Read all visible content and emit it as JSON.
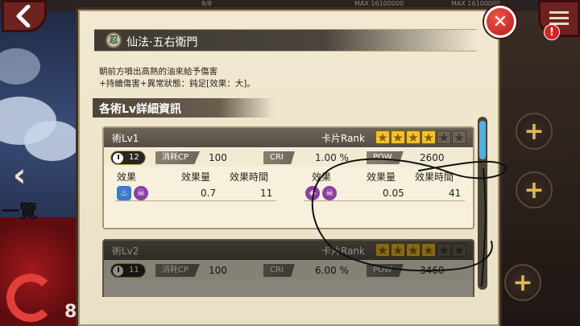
{
  "top_bar": {
    "item1": "8/8",
    "item2": "MAX 16100000",
    "item3": "MAX 16100000"
  },
  "dialog": {
    "title": "仙法·五右衛門",
    "title_badge": "忍",
    "description_line1": "朝前方噴出高熱的油來給予傷害",
    "description_line2": "+持續傷害+異常狀態：鈍足[效果：大]。",
    "section_header": "各術Lv詳細資訊"
  },
  "cards": [
    {
      "level_label": "術Lv1",
      "rank_label": "卡片Rank",
      "stars_filled": 4,
      "stars_total": 6,
      "cooldown": "12",
      "cp_label": "消耗CP",
      "cp_value": "100",
      "cri_label": "CRI",
      "cri_value": "1.00 %",
      "pow_label": "POW",
      "pow_value": "2600",
      "effect_headers": [
        "效果",
        "效果量",
        "效果時間"
      ],
      "effect_left_amount": "0.7",
      "effect_left_time": "11",
      "effect_right_amount": "0.05",
      "effect_right_time": "41"
    },
    {
      "level_label": "術Lv2",
      "rank_label": "卡片Rank",
      "stars_filled": 4,
      "stars_total": 6,
      "cooldown": "11",
      "cp_label": "消耗CP",
      "cp_value": "100",
      "cri_label": "CRI",
      "cri_value": "6.00 %",
      "pow_label": "POW",
      "pow_value": "3460"
    }
  ],
  "background": {
    "side_text": "一覽",
    "bottom_number": "8"
  },
  "icons": {
    "close": "close-icon",
    "back": "back-arrow-icon",
    "menu": "menu-icon",
    "alert": "alert-icon"
  },
  "colors": {
    "accent_red": "#d1242a",
    "star_gold": "#f0c32c",
    "scroll_blue": "#53b0e0"
  }
}
